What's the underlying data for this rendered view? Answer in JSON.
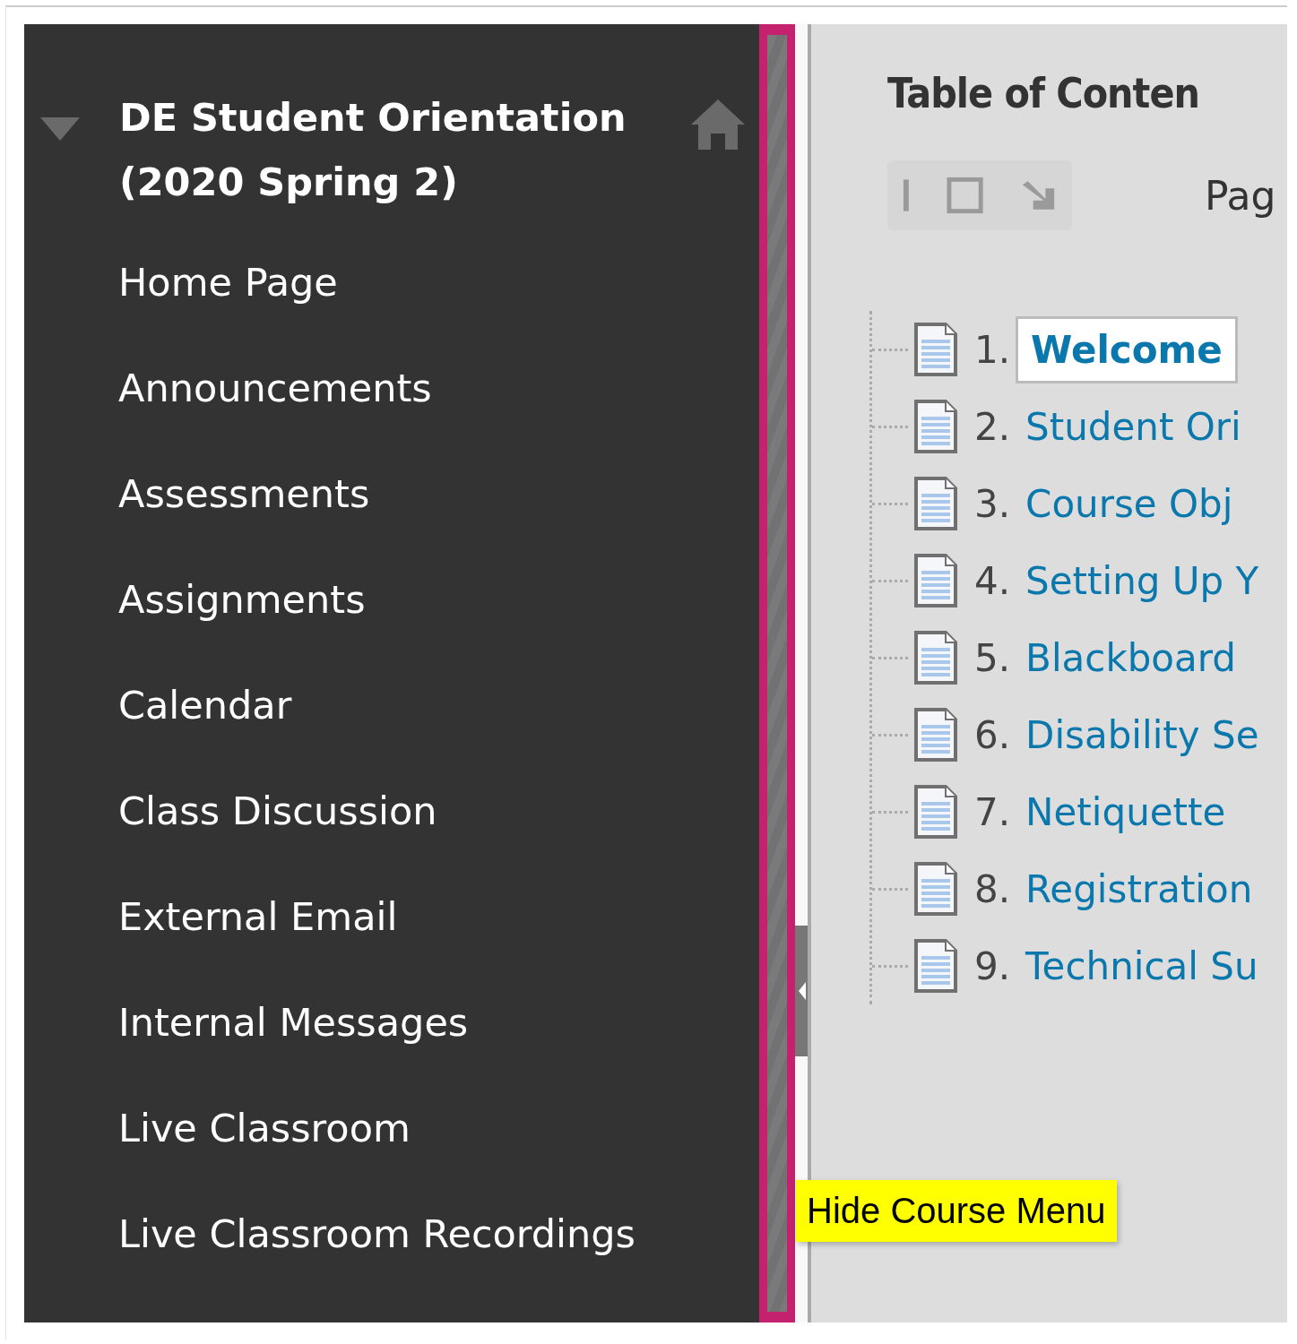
{
  "course_menu": {
    "title": "DE Student Orientation (2020 Spring 2)",
    "expanded": true,
    "items": [
      {
        "label": "Home Page"
      },
      {
        "label": "Announcements"
      },
      {
        "label": "Assessments"
      },
      {
        "label": "Assignments"
      },
      {
        "label": "Calendar"
      },
      {
        "label": "Class Discussion"
      },
      {
        "label": "External Email"
      },
      {
        "label": "Internal Messages"
      },
      {
        "label": "Live Classroom"
      },
      {
        "label": "Live Classroom Recordings"
      }
    ]
  },
  "tooltip": "Hide Course Menu",
  "content": {
    "heading": "Table of Conten",
    "pager_label": "Pag",
    "toc": [
      {
        "number": "1.",
        "title": "Welcome",
        "selected": true
      },
      {
        "number": "2.",
        "title": "Student Ori",
        "selected": false
      },
      {
        "number": "3.",
        "title": "Course Obj",
        "selected": false
      },
      {
        "number": "4.",
        "title": "Setting Up Y",
        "selected": false
      },
      {
        "number": "5.",
        "title": "Blackboard",
        "selected": false
      },
      {
        "number": "6.",
        "title": "Disability Se",
        "selected": false
      },
      {
        "number": "7.",
        "title": "Netiquette",
        "selected": false
      },
      {
        "number": "8.",
        "title": "Registration",
        "selected": false
      },
      {
        "number": "9.",
        "title": "Technical Su",
        "selected": false
      }
    ]
  }
}
